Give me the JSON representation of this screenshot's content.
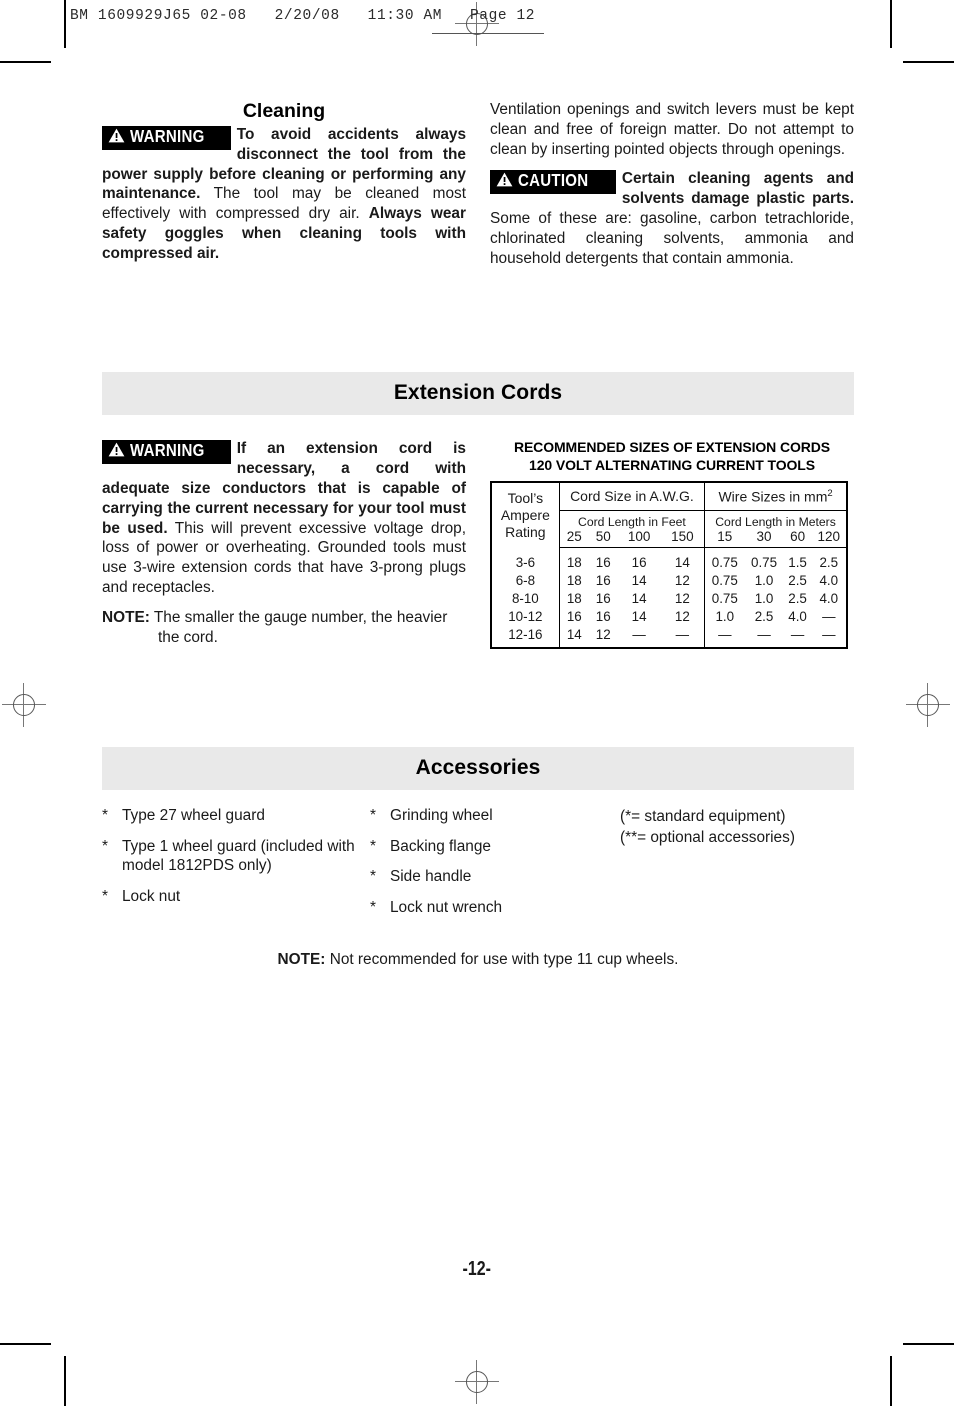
{
  "imprint": {
    "text": "BM 1609929J65 02-08   2/20/08   11:30 AM   Page 12"
  },
  "page_number": "-12-",
  "cleaning": {
    "heading": "Cleaning",
    "badge_word": "WARNING",
    "para1_bold_1": "To avoid accidents always disconnect the tool from the power supply before cleaning or performing any maintenance.",
    "para1_plain_1": " The tool may be cleaned most effectively with compressed dry air. ",
    "para1_bold_2": "Always wear safety goggles when cleaning tools with compressed air."
  },
  "ventilation": {
    "para": "Ventilation openings and switch levers must be kept clean and free of foreign matter. Do not attempt to clean by inserting pointed objects through openings.",
    "badge_word": "CAUTION",
    "caution_bold": "Certain cleaning agents and solvents damage plastic parts.",
    "caution_plain": " Some of these are: gasoline, carbon tetrachloride, chlorinated cleaning solvents, ammonia and household detergents that contain ammonia."
  },
  "extension_cords": {
    "section_title": "Extension Cords",
    "badge_word": "WARNING",
    "para_bold": "If an extension cord is necessary, a cord with adequate size conductors that is capable of carrying the current necessary for your tool must be used.",
    "para_plain": " This will prevent excessive voltage drop, loss of power or overheating.  Grounded tools must use 3-wire extension cords that have 3-prong plugs and receptacles.",
    "note_label": "NOTE:",
    "note_text": "The smaller the gauge number, the heavier the cord."
  },
  "cord_table": {
    "title_line1": "RECOMMENDED SIZES OF EXTENSION CORDS",
    "title_line2": "120 VOLT ALTERNATING CURRENT TOOLS",
    "tool_header_line1": "Tool’s",
    "tool_header_line2": "Ampere",
    "tool_header_line3": "Rating",
    "group_awg": "Cord Size in A.W.G.",
    "group_mm2_text": "Wire Sizes in mm",
    "group_mm2_sup": "2",
    "sub_feet": "Cord Length in Feet",
    "sub_meters": "Cord Length in Meters",
    "feet_cols": [
      "25",
      "50",
      "100",
      "150"
    ],
    "meter_cols": [
      "15",
      "30",
      "60",
      "120"
    ],
    "rows": [
      {
        "amp": "3-6",
        "awg": [
          "18",
          "16",
          "16",
          "14"
        ],
        "mm2": [
          "0.75",
          "0.75",
          "1.5",
          "2.5"
        ]
      },
      {
        "amp": "6-8",
        "awg": [
          "18",
          "16",
          "14",
          "12"
        ],
        "mm2": [
          "0.75",
          "1.0",
          "2.5",
          "4.0"
        ]
      },
      {
        "amp": "8-10",
        "awg": [
          "18",
          "16",
          "14",
          "12"
        ],
        "mm2": [
          "0.75",
          "1.0",
          "2.5",
          "4.0"
        ]
      },
      {
        "amp": "10-12",
        "awg": [
          "16",
          "16",
          "14",
          "12"
        ],
        "mm2": [
          "1.0",
          "2.5",
          "4.0",
          "—"
        ]
      },
      {
        "amp": "12-16",
        "awg": [
          "14",
          "12",
          "—",
          "—"
        ],
        "mm2": [
          "—",
          "—",
          "—",
          "—"
        ]
      }
    ]
  },
  "accessories": {
    "section_title": "Accessories",
    "star": "*",
    "column_a": [
      "Type 27 wheel guard",
      "Type 1 wheel guard (included with model 1812PDS only)",
      "Lock nut"
    ],
    "column_b": [
      "Grinding wheel",
      "Backing flange",
      "Side handle",
      "Lock nut wrench"
    ],
    "legend_line1": "(*= standard equipment)",
    "legend_line2": "(**= optional accessories)",
    "final_note_label": "NOTE:",
    "final_note_text": " Not recommended for use with type 11 cup wheels."
  }
}
